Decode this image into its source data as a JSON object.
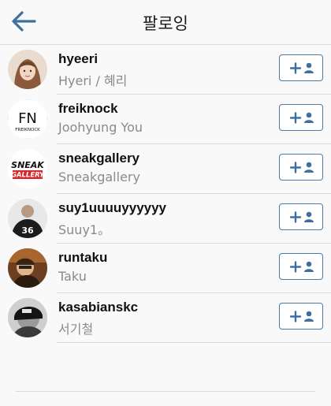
{
  "header": {
    "title": "팔로잉",
    "back_icon": "arrow-left-icon",
    "accent_color": "#3e6f9f"
  },
  "users": [
    {
      "username": "hyeeri",
      "fullname": "Hyeri / 혜리",
      "action_icon": "follow-plus-person-icon"
    },
    {
      "username": "freiknock",
      "fullname": "Joohyung You",
      "avatar_text": "FN",
      "avatar_subtext": "FREIKNOCK",
      "action_icon": "follow-plus-person-icon"
    },
    {
      "username": "sneakgallery",
      "fullname": "Sneakgallery",
      "avatar_text": "SNEAK",
      "avatar_subtext": "GALLERY",
      "action_icon": "follow-plus-person-icon"
    },
    {
      "username": "suy1uuuuyyyyyy",
      "fullname": "Suuy1。",
      "avatar_text": "36",
      "action_icon": "follow-plus-person-icon"
    },
    {
      "username": "runtaku",
      "fullname": "Taku",
      "action_icon": "follow-plus-person-icon"
    },
    {
      "username": "kasabianskc",
      "fullname": "서기철",
      "action_icon": "follow-plus-person-icon"
    }
  ],
  "colors": {
    "button_border": "#4a7aa8",
    "divider": "#d9d9d9",
    "secondary_text": "#8a8a8a"
  }
}
